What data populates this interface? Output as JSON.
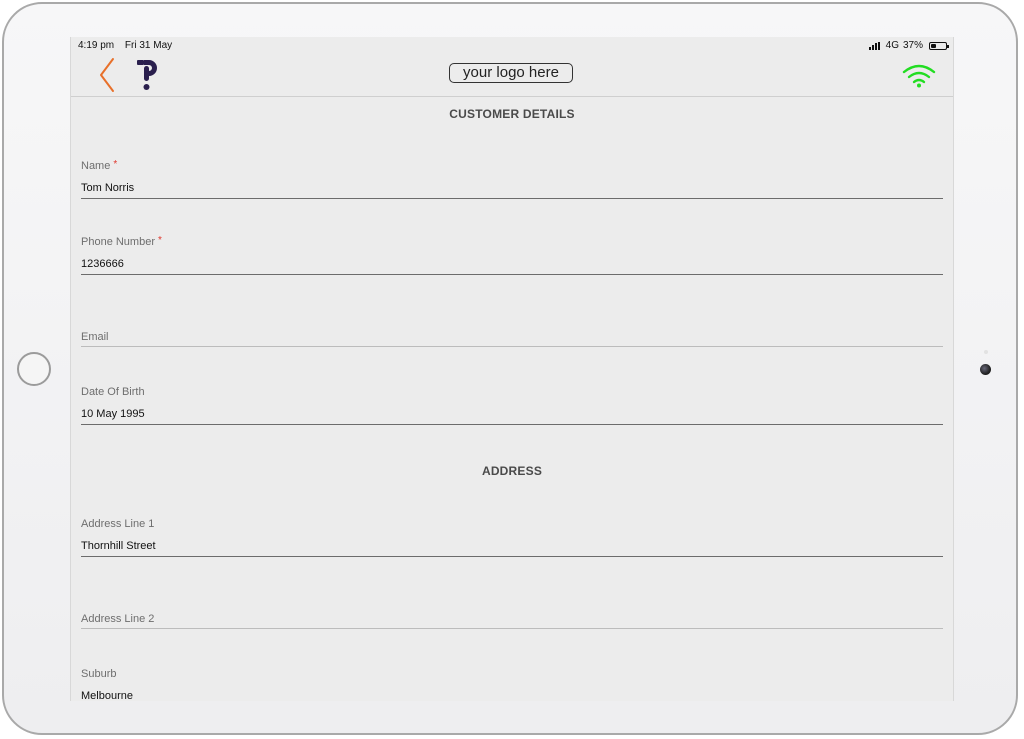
{
  "status_bar": {
    "time": "4:19 pm",
    "date": "Fri 31 May",
    "network": "4G",
    "battery": "37%",
    "battery_level": 0.37
  },
  "nav": {
    "logo_placeholder": "your logo here",
    "back_icon": "chevron-left-icon",
    "connection_icon": "wifi-icon",
    "accent_color": "#e8702a",
    "wifi_color": "#22dd22",
    "brand_color": "#2a1f4d"
  },
  "customer_details": {
    "title": "CUSTOMER DETAILS",
    "fields": [
      {
        "label": "Name",
        "required": "*",
        "value": "Tom Norris"
      },
      {
        "label": "Phone Number",
        "required": "*",
        "value": "1236666"
      },
      {
        "label": "Email",
        "value": ""
      },
      {
        "label": "Date Of Birth",
        "value": "10 May 1995"
      }
    ]
  },
  "address": {
    "title": "ADDRESS",
    "fields": [
      {
        "label": "Address Line 1",
        "value": "Thornhill Street"
      },
      {
        "label": "Address Line 2",
        "value": ""
      },
      {
        "label": "Suburb",
        "value": "Melbourne"
      }
    ]
  }
}
